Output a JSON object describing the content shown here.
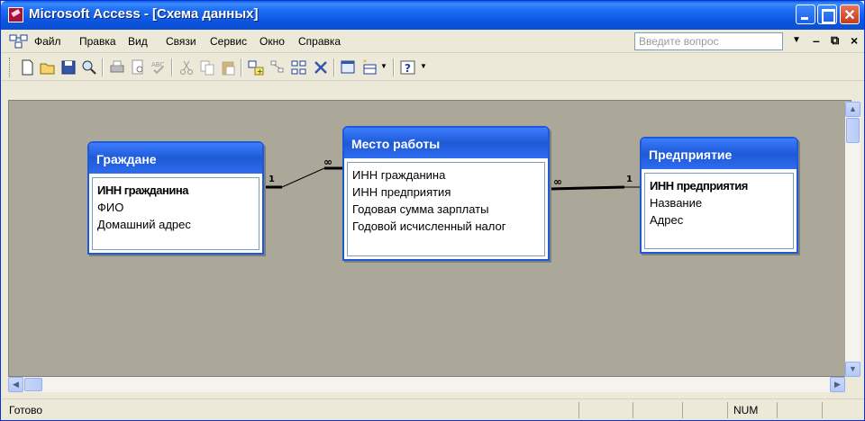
{
  "window": {
    "title": "Microsoft Access - [Схема данных]"
  },
  "menu": {
    "items": [
      "Файл",
      "Правка",
      "Вид",
      "Связи",
      "Сервис",
      "Окно",
      "Справка"
    ],
    "ask_placeholder": "Введите вопрос"
  },
  "toolbar": {
    "icons": [
      "new-icon",
      "open-icon",
      "save-icon",
      "search-icon",
      "print-icon",
      "print-preview-icon",
      "spelling-icon",
      "cut-icon",
      "copy-icon",
      "paste-icon",
      "show-table-icon",
      "show-direct-icon",
      "show-all-icon",
      "delete-icon",
      "database-window-icon",
      "new-object-icon",
      "help-icon"
    ]
  },
  "diagram": {
    "tables": [
      {
        "title": "Граждане",
        "fields": [
          {
            "name": "ИНН гражданина",
            "key": true
          },
          {
            "name": "ФИО",
            "key": false
          },
          {
            "name": "Домашний адрес",
            "key": false
          }
        ]
      },
      {
        "title": "Место работы",
        "fields": [
          {
            "name": "ИНН гражданина",
            "key": false
          },
          {
            "name": "ИНН предприятия",
            "key": false
          },
          {
            "name": "Годовая сумма зарплаты",
            "key": false
          },
          {
            "name": "Годовой исчисленный налог",
            "key": false
          }
        ]
      },
      {
        "title": "Предприятие",
        "fields": [
          {
            "name": "ИНН предприятия",
            "key": true
          },
          {
            "name": "Название",
            "key": false
          },
          {
            "name": "Адрес",
            "key": false
          }
        ]
      }
    ],
    "relationships": [
      {
        "from": "Граждане",
        "from_label": "1",
        "to": "Место работы",
        "to_label": "∞"
      },
      {
        "from": "Предприятие",
        "from_label": "1",
        "to": "Место работы",
        "to_label": "∞"
      }
    ]
  },
  "status": {
    "text": "Готово",
    "num": "NUM"
  }
}
